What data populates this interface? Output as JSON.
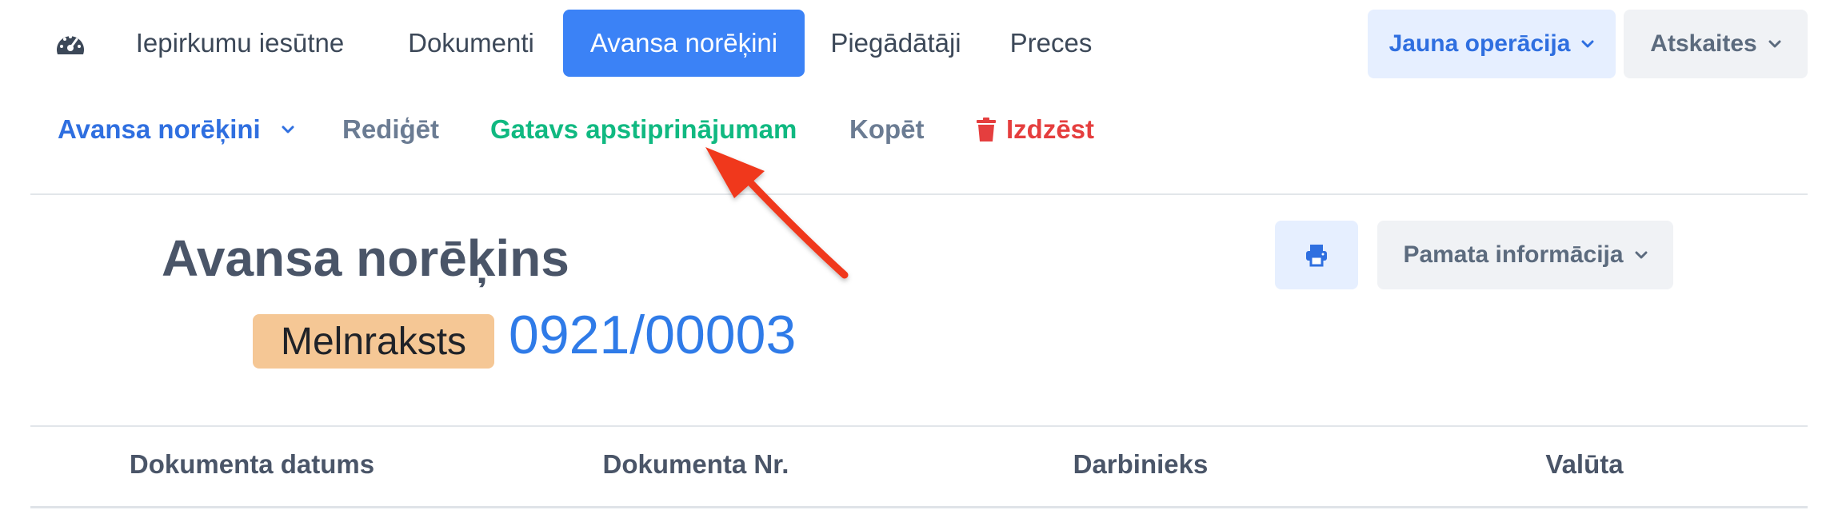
{
  "topnav": {
    "dashboard_icon": "speedometer-icon",
    "items": [
      {
        "label": "Iepirkumu iesūtne",
        "active": false
      },
      {
        "label": "Dokumenti",
        "active": false
      },
      {
        "label": "Avansa norēķini",
        "active": true
      },
      {
        "label": "Piegādātāji",
        "active": false
      },
      {
        "label": "Preces",
        "active": false
      }
    ],
    "new_operation_label": "Jauna operācija",
    "reports_label": "Atskaites"
  },
  "actionbar": {
    "module_label": "Avansa norēķini",
    "edit_label": "Rediģēt",
    "ready_label": "Gatavs apstiprinājumam",
    "copy_label": "Kopēt",
    "delete_label": "Izdzēst",
    "delete_icon": "trash-icon"
  },
  "document": {
    "title": "Avansa norēķins",
    "status": "Melnraksts",
    "number": "0921/00003",
    "print_icon": "printer-icon",
    "basic_info_label": "Pamata informācija"
  },
  "table": {
    "columns": [
      "Dokumenta datums",
      "Dokumenta Nr.",
      "Darbinieks",
      "Valūta"
    ]
  },
  "colors": {
    "accent": "#3b82f6",
    "success": "#10b981",
    "danger": "#e53e3e",
    "status_badge": "#f5c795",
    "annotation_arrow": "#f0391f"
  }
}
